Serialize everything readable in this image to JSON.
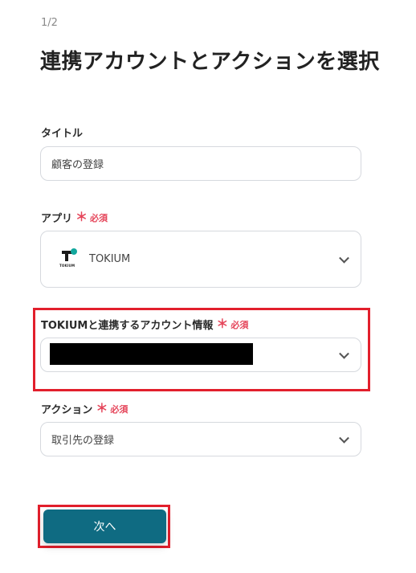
{
  "step_indicator": "1/2",
  "page_title": "連携アカウントとアクションを選択",
  "required_mark": "＊",
  "required_text": "必須",
  "title_field": {
    "label": "タイトル",
    "value": "顧客の登録"
  },
  "app_field": {
    "label": "アプリ",
    "value": "TOKIUM",
    "logo_text": "TOKIUM"
  },
  "account_field": {
    "label": "TOKIUMと連携するアカウント情報",
    "value": ""
  },
  "action_field": {
    "label": "アクション",
    "value": "取引先の登録"
  },
  "next_button": {
    "label": "次へ"
  },
  "colors": {
    "primary": "#0f6b82",
    "required": "#e5455a",
    "highlight": "#e21f2c",
    "logo_accent": "#12a79d"
  }
}
